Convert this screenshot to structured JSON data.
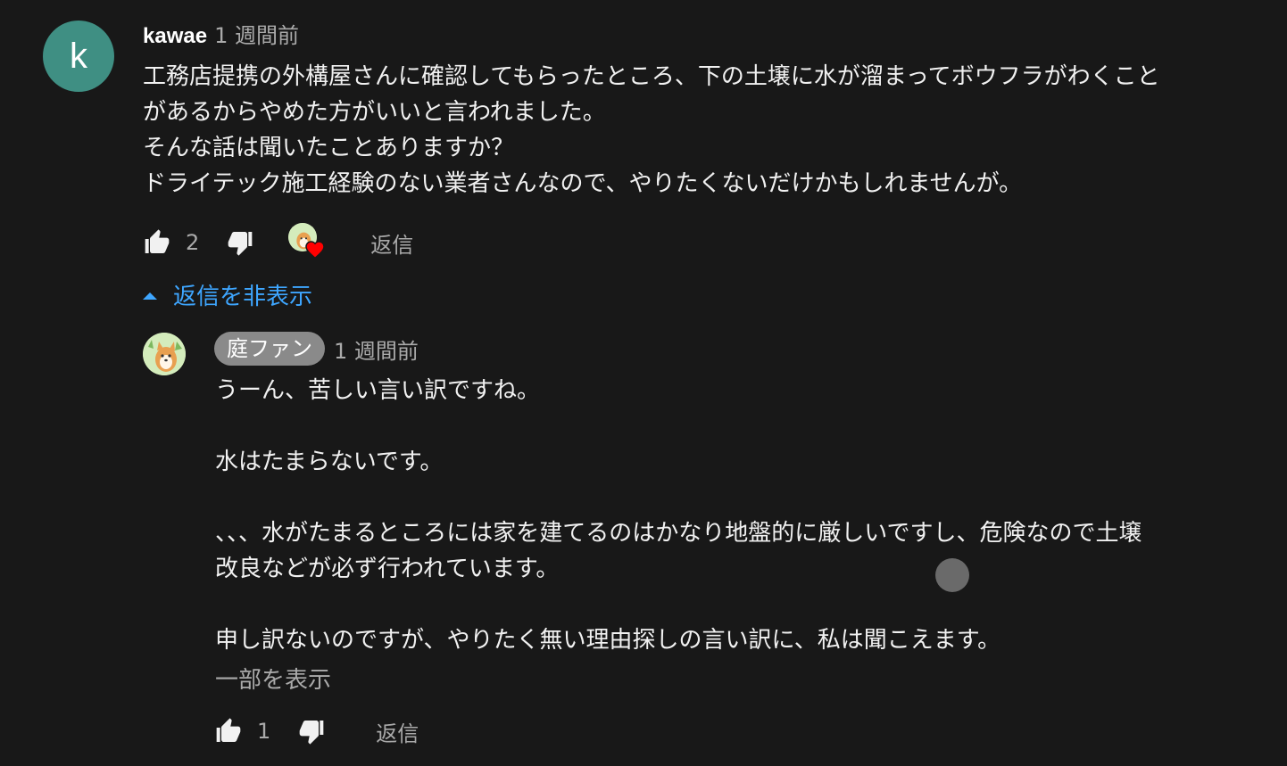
{
  "comment": {
    "avatar_letter": "k",
    "author": "kawae",
    "timestamp": "1 週間前",
    "lines": [
      "工務店提携の外構屋さんに確認してもらったところ、下の土壌に水が溜まってボウフラがわくこと",
      "があるからやめた方がいいと言われました。",
      "そんな話は聞いたことありますか？",
      "ドライテック施工経験のない業者さんなので、やりたくないだけかもしれませんが。"
    ],
    "like_count": "2",
    "reply_label": "返信",
    "hide_replies_label": "返信を非表示"
  },
  "reply": {
    "author": "庭ファン",
    "timestamp": "1 週間前",
    "lines": [
      "うーん、苦しい言い訳ですね。",
      "",
      "水はたまらないです。",
      "",
      "、、、水がたまるところには家を建てるのはかなり地盤的に厳しいですし、危険なので土壌",
      "改良などが必ず行われています。",
      "",
      "申し訳ないのですが、やりたく無い理由探しの言い訳に、私は聞こえます。"
    ],
    "show_more_label": "一部を表示",
    "like_count": "1",
    "reply_label": "返信"
  },
  "colors": {
    "background": "#181818",
    "link": "#3ea6ff",
    "heart": "#ff0000",
    "avatar": "#3f8f83"
  }
}
